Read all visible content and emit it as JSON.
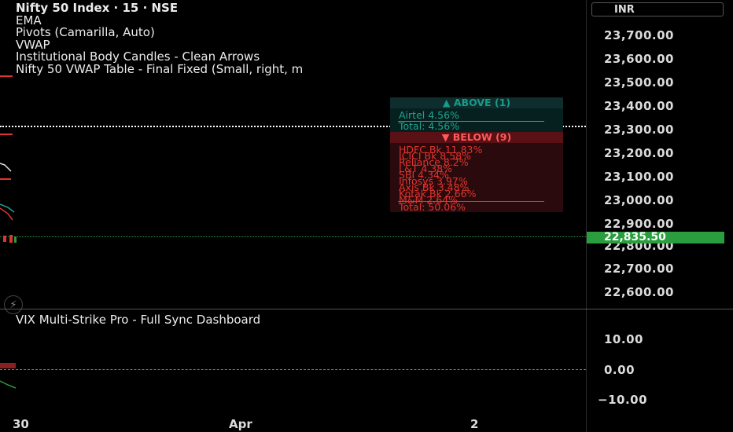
{
  "legend": {
    "title": "Nifty 50 Index · 15 · NSE",
    "studies": [
      "EMA",
      "Pivots (Camarilla, Auto)",
      "VWAP",
      "Institutional Body Candles - Clean Arrows",
      "Nifty 50 VWAP Table - Final Fixed (Small, right, m"
    ]
  },
  "price_axis": {
    "currency": "INR",
    "ticks": [
      "23,700.00",
      "23,600.00",
      "23,500.00",
      "23,400.00",
      "23,300.00",
      "23,200.00",
      "23,100.00",
      "23,000.00",
      "22,900.00",
      "22,800.00",
      "22,700.00",
      "22,600.00"
    ],
    "current_price": "22,835.50",
    "current_price_color": "#2a9d3f"
  },
  "vix_panel": {
    "title": "VIX Multi-Strike Pro - Full Sync Dashboard",
    "ticks": [
      "10.00",
      "0.00",
      "−10.00"
    ]
  },
  "time_axis": {
    "labels": [
      "30",
      "Apr",
      "2"
    ]
  },
  "vwap_table": {
    "above_header": "▲ ABOVE (1)",
    "above_rows": [
      "Airtel  4.56%",
      "Total: 4.56%"
    ],
    "below_header": "▼ BELOW (9)",
    "below_rows": [
      "HDFC Bk  11.83%",
      "ICICI Bk  8.58%",
      "Reliance  8.2%",
      "L&T  4.38%",
      "SBI  4.34%",
      "Infosys  3.97%",
      "Axis Bk  3.48%",
      "Kotak Bk  2.66%",
      "M&M  2.64%"
    ],
    "below_total": "Total: 50.06%",
    "colors": {
      "above": "#1fa38f",
      "below": "#e0342e"
    }
  },
  "icons": {
    "bolt": "lightning-icon"
  }
}
